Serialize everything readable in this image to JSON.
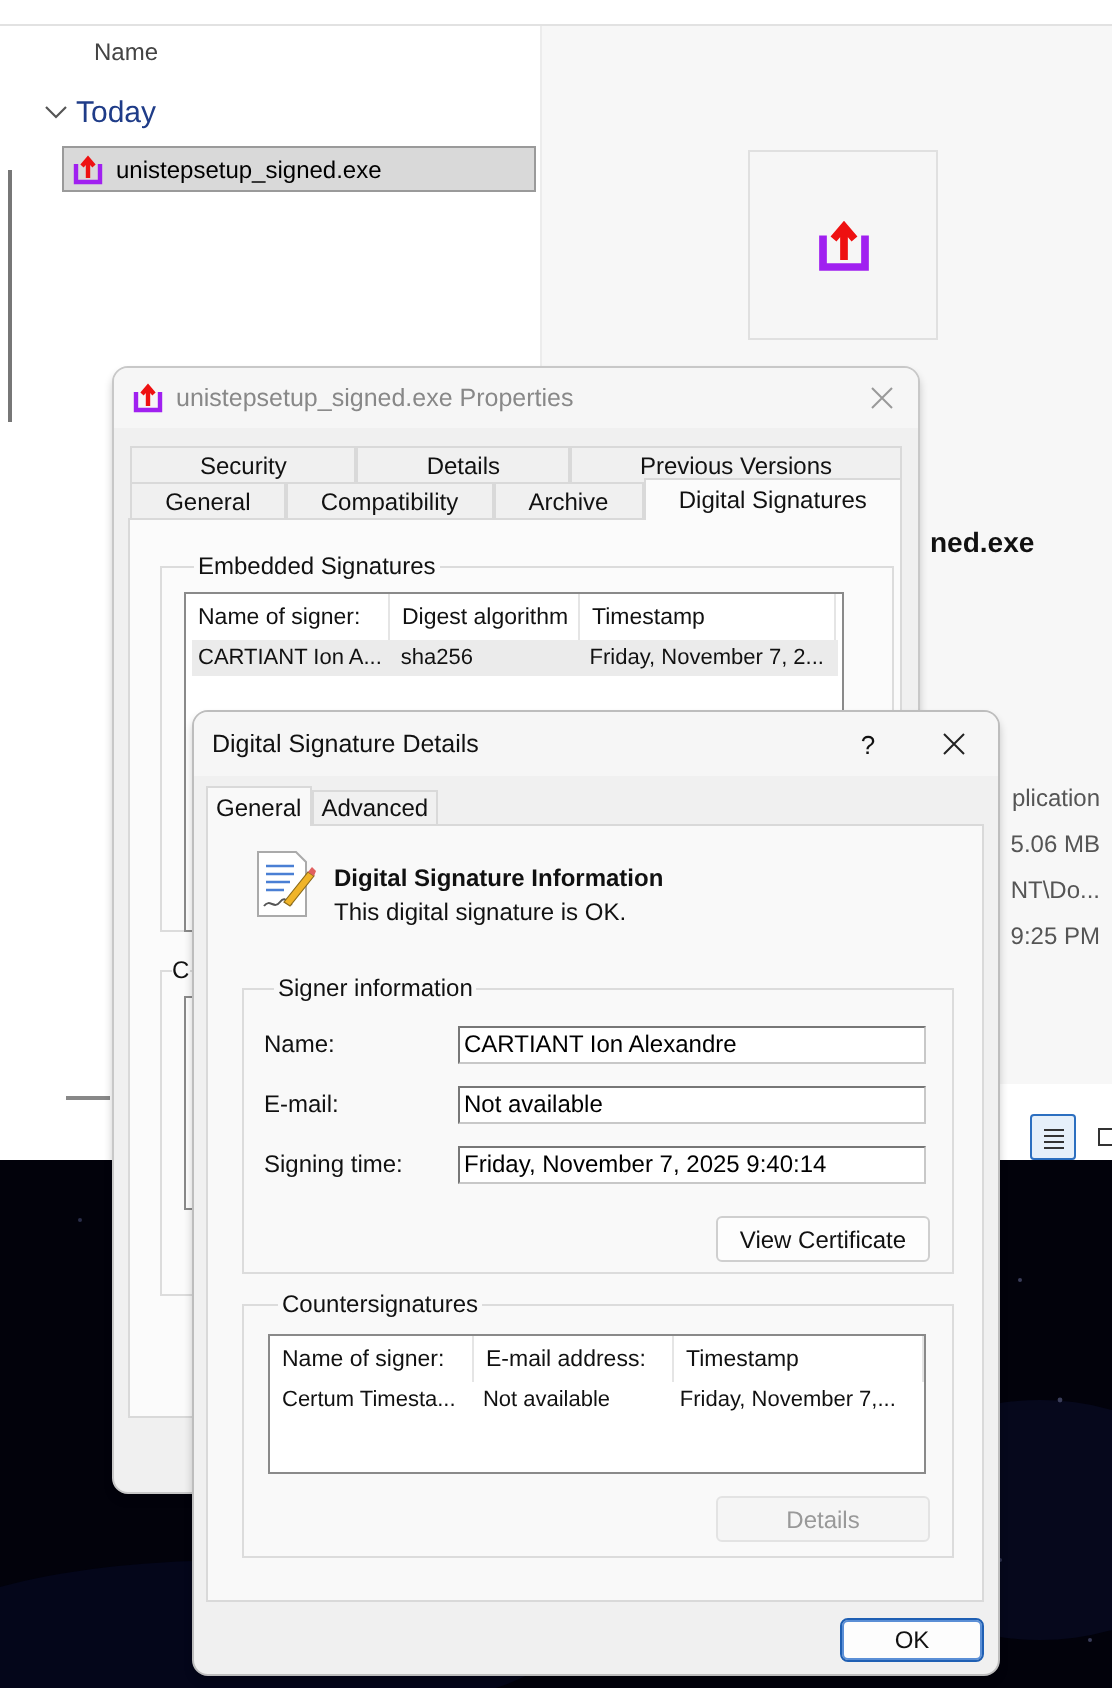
{
  "explorer": {
    "column_header": "Name",
    "group": {
      "label": "Today",
      "expanded": true
    },
    "files": [
      {
        "name": "unistepsetup_signed.exe",
        "selected": true
      }
    ],
    "preview": {
      "title": "ned.exe",
      "details": [
        "plication",
        "5.06 MB",
        "NT\\Do...",
        "9:25 PM"
      ]
    },
    "view_buttons": [
      {
        "selected": true
      },
      {
        "selected": false
      }
    ]
  },
  "properties": {
    "title": "unistepsetup_signed.exe Properties",
    "tab_rows": [
      {
        "tabs": [
          {
            "label": "Security",
            "selected": false
          },
          {
            "label": "Details",
            "selected": false
          },
          {
            "label": "Previous Versions",
            "selected": false
          }
        ]
      },
      {
        "tabs": [
          {
            "label": "General",
            "selected": false
          },
          {
            "label": "Compatibility",
            "selected": false
          },
          {
            "label": "Archive",
            "selected": false
          },
          {
            "label": "Digital Signatures",
            "selected": true
          }
        ]
      }
    ],
    "embedded_signatures": {
      "label": "Embedded Signatures",
      "columns": [
        "Name of signer:",
        "Digest algorithm",
        "Timestamp"
      ],
      "rows": [
        {
          "cells": [
            "CARTIANT Ion A...",
            "sha256",
            "Friday, November 7, 2..."
          ],
          "selected": true
        }
      ]
    },
    "group_2": {
      "label": "C"
    }
  },
  "signature_details": {
    "title": "Digital Signature Details",
    "help": "?",
    "tabs": [
      {
        "label": "General",
        "selected": true
      },
      {
        "label": "Advanced",
        "selected": false
      }
    ],
    "info_title": "Digital Signature Information",
    "info_status": "This digital signature is OK.",
    "signer_information": {
      "label": "Signer information",
      "fields": [
        {
          "label": "Name:",
          "value": "CARTIANT Ion Alexandre"
        },
        {
          "label": "E-mail:",
          "value": "Not available"
        },
        {
          "label": "Signing time:",
          "value": "Friday, November 7, 2025 9:40:14"
        }
      ],
      "view_certificate": "View Certificate"
    },
    "countersignatures": {
      "label": "Countersignatures",
      "columns": [
        "Name of signer:",
        "E-mail address:",
        "Timestamp"
      ],
      "rows": [
        {
          "cells": [
            "Certum Timesta...",
            "Not available",
            "Friday, November 7,..."
          ],
          "selected": false
        }
      ],
      "details_button": {
        "label": "Details",
        "disabled": true
      }
    },
    "ok": "OK"
  }
}
